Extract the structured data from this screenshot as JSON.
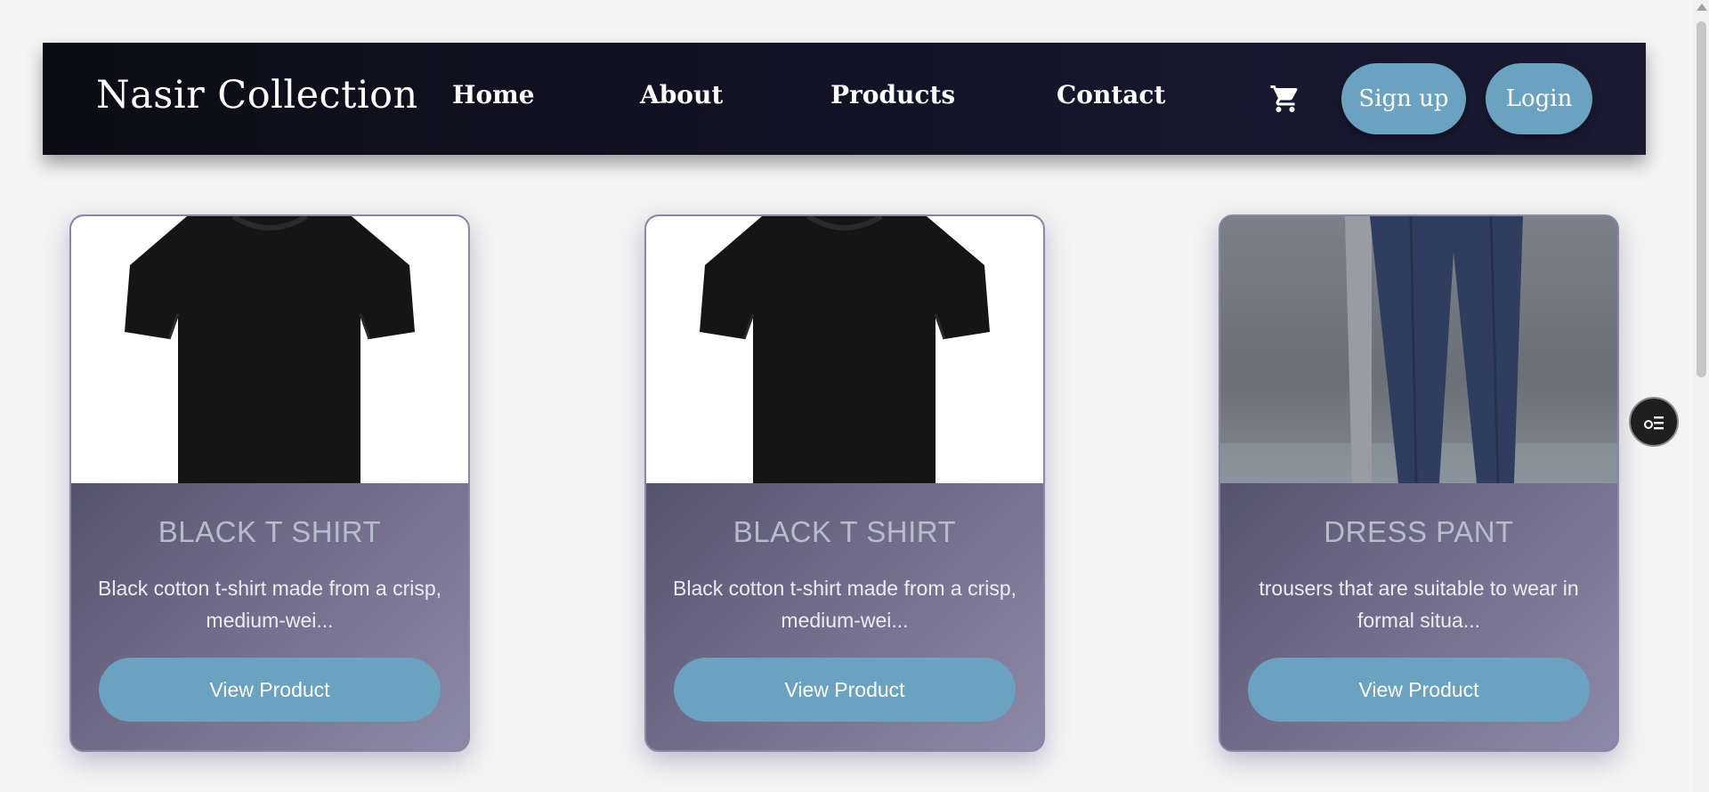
{
  "header": {
    "brand": "Nasir Collection",
    "nav": [
      {
        "label": "Home"
      },
      {
        "label": "About"
      },
      {
        "label": "Products"
      },
      {
        "label": "Contact"
      }
    ],
    "signup_label": "Sign up",
    "login_label": "Login",
    "cart_icon": "shopping-cart-icon"
  },
  "products": [
    {
      "title": "BLACK T SHIRT",
      "description": "Black cotton t-shirt made from a crisp, medium-wei...",
      "button": "View Product",
      "image": "black-tshirt"
    },
    {
      "title": "BLACK T SHIRT",
      "description": "Black cotton t-shirt made from a crisp, medium-wei...",
      "button": "View Product",
      "image": "black-tshirt"
    },
    {
      "title": "DRESS PANT",
      "description": "trousers that are suitable to wear in formal situa...",
      "button": "View Product",
      "image": "dress-pant"
    }
  ],
  "colors": {
    "navbar": "#0c0c17",
    "accent": "#6aa2bf",
    "card_gradient_start": "#3e3c55",
    "card_gradient_end": "#8d89a8"
  }
}
